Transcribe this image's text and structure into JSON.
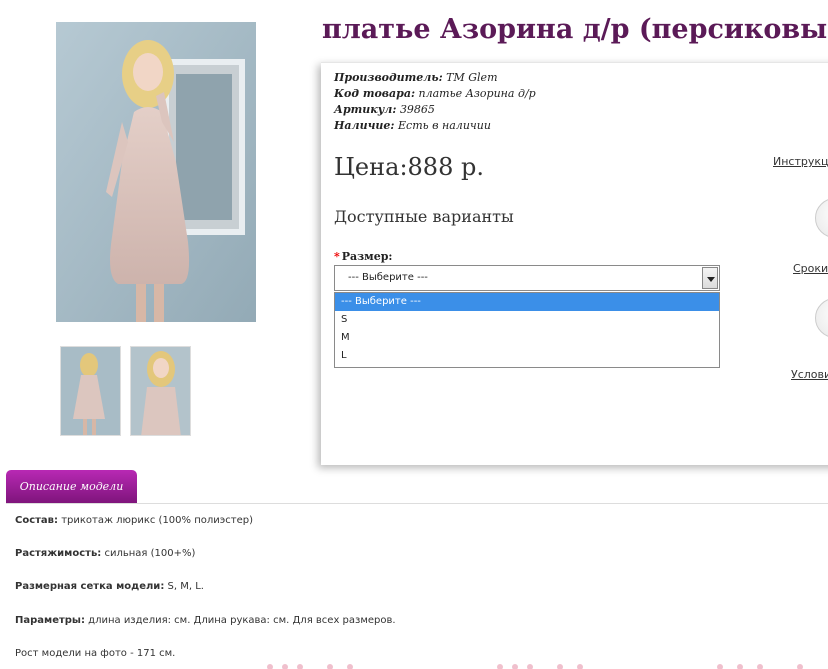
{
  "product": {
    "title": "платье Азорина д/р (персиковый)",
    "specs": [
      {
        "label": "Производитель:",
        "value": "TM Glem"
      },
      {
        "label": "Код товара:",
        "value": "платье Азорина д/р"
      },
      {
        "label": "Артикул:",
        "value": "39865"
      },
      {
        "label": "Наличие:",
        "value": "Есть в наличии"
      }
    ],
    "price": "Цена:888 р.",
    "variants_title": "Доступные варианты",
    "size_label": "Размер:",
    "size_required_mark": "*",
    "size_selected": "--- Выберите ---",
    "size_options": [
      "--- Выберите ---",
      "S",
      "M",
      "L"
    ]
  },
  "sidebar_links": {
    "instructions": "Инструкци",
    "terms": "Сроки",
    "conditions": "Услови"
  },
  "tabs": {
    "description": "Описание модели"
  },
  "description": [
    {
      "label": "Состав:",
      "value": " трикотаж люрикс (100% полиэстер)"
    },
    {
      "label": "Растяжимость:",
      "value": " сильная (100+%)"
    },
    {
      "label": "Размерная сетка модели:",
      "value": " S, M, L."
    },
    {
      "label": "Параметры:",
      "value": " длина изделия: см. Длина рукава: см. Для всех размеров."
    },
    {
      "label": "",
      "value": "Рост модели на фото - 171 см."
    }
  ],
  "colors": {
    "title": "#5b1a57",
    "tab": "#9b1f98",
    "dropdown_highlight": "#3b8fe8",
    "required": "#e00000"
  }
}
